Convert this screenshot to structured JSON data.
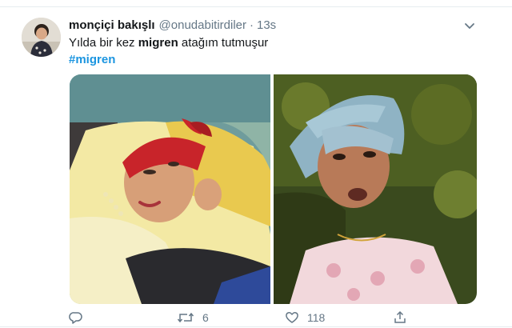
{
  "tweet": {
    "display_name": "monçiçi bakışlı",
    "handle": "@onudabitirdiler",
    "separator": "·",
    "timestamp": "13s",
    "text_before": "Yılda bir kez ",
    "text_bold": "migren",
    "text_after": " atağım tutmuşur",
    "hashtag": "#migren"
  },
  "actions": {
    "reply_count": "",
    "retweet_count": "6",
    "like_count": "118"
  },
  "icons": {
    "caret": "chevron-down-icon",
    "reply": "reply-icon",
    "retweet": "retweet-icon",
    "like": "heart-icon",
    "share": "share-icon"
  },
  "colors": {
    "link": "#1b95e0",
    "muted": "#657786",
    "text": "#14171a"
  }
}
